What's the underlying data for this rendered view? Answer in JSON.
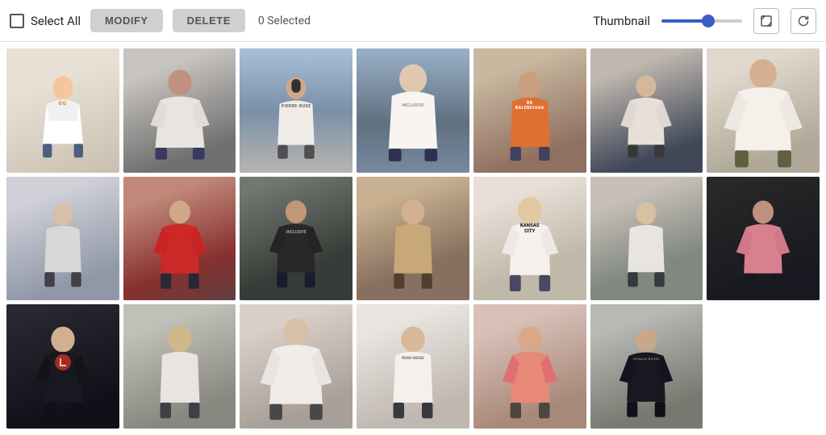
{
  "toolbar": {
    "select_all_label": "Select All",
    "modify_label": "MODIFY",
    "delete_label": "DELETE",
    "selected_count": "0 Selected",
    "thumbnail_label": "Thumbnail",
    "slider_value": 60,
    "slider_min": 0,
    "slider_max": 100
  },
  "grid": {
    "rows": [
      [
        {
          "id": "r1c1",
          "bg": "r1c1",
          "person_color": "#f0e8e0",
          "shirt": "white",
          "text": ""
        },
        {
          "id": "r1c2",
          "bg": "r1c2",
          "person_color": "#e0d8d0",
          "shirt": "white",
          "text": ""
        },
        {
          "id": "r1c3",
          "bg": "r1c3",
          "person_color": "#d8d0c8",
          "shirt": "white",
          "text": "PIERRE-BUDE"
        },
        {
          "id": "r1c4",
          "bg": "r1c4",
          "person_color": "#e8e4e0",
          "shirt": "white",
          "text": "INCLUSIVE"
        },
        {
          "id": "r1c5",
          "bg": "r1c5",
          "person_color": "#d8c8b8",
          "shirt": "orange",
          "text": "BB BALENCIAGA"
        },
        {
          "id": "r1c6",
          "bg": "r1c6",
          "person_color": "#d0c8c0",
          "shirt": "white",
          "text": ""
        },
        {
          "id": "r1c7",
          "bg": "r1c7",
          "person_color": "#e8e0d8",
          "shirt": "white",
          "text": ""
        }
      ],
      [
        {
          "id": "r2c1",
          "bg": "r2c1",
          "person_color": "#d0d0d0",
          "shirt": "white",
          "text": ""
        },
        {
          "id": "r2c2",
          "bg": "r2c2",
          "person_color": "#d8c0b8",
          "shirt": "red",
          "text": ""
        },
        {
          "id": "r2c3",
          "bg": "r2c3",
          "person_color": "#c0b8b0",
          "shirt": "black",
          "text": "INCLUSIVE"
        },
        {
          "id": "r2c4",
          "bg": "r2c4",
          "person_color": "#d0c0a8",
          "shirt": "tan",
          "text": ""
        },
        {
          "id": "r2c5",
          "bg": "r2c5",
          "person_color": "#f0ece8",
          "shirt": "white",
          "text": "KANSAS CITY"
        },
        {
          "id": "r2c6",
          "bg": "r2c6",
          "person_color": "#d0c8c0",
          "shirt": "white",
          "text": ""
        },
        {
          "id": "r2c7",
          "bg": "r2c7",
          "person_color": "#383030",
          "shirt": "pink",
          "text": ""
        }
      ],
      [
        {
          "id": "r3c1",
          "bg": "r3c1",
          "person_color": "#202028",
          "shirt": "black",
          "text": ""
        },
        {
          "id": "r3c2",
          "bg": "r3c2",
          "person_color": "#c8c8c0",
          "shirt": "white",
          "text": ""
        },
        {
          "id": "r3c3",
          "bg": "r3c3",
          "person_color": "#ddd8d0",
          "shirt": "white",
          "text": ""
        },
        {
          "id": "r3c4",
          "bg": "r3c4",
          "person_color": "#f0ece8",
          "shirt": "white",
          "text": "ROAD HOUSE"
        },
        {
          "id": "r3c5",
          "bg": "r3c5",
          "person_color": "#e0c8c0",
          "shirt": "coral",
          "text": ""
        },
        {
          "id": "r3c6",
          "bg": "r3c6",
          "person_color": "#c0c0bc",
          "shirt": "black",
          "text": "HUMAN BEING"
        },
        {
          "id": "empty",
          "bg": "",
          "empty": true
        }
      ]
    ]
  }
}
